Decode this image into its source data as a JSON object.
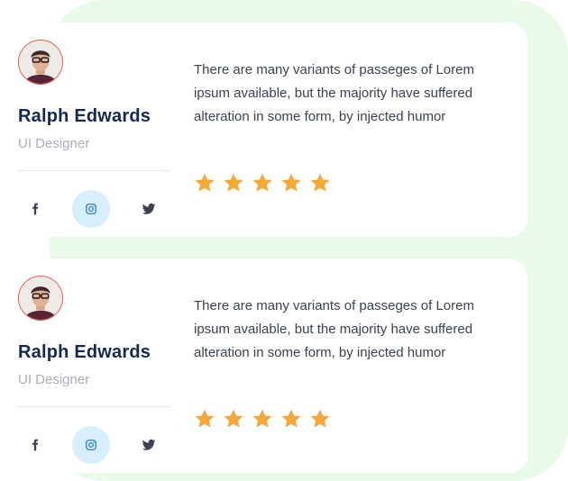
{
  "colors": {
    "background_shape": "#eafaea",
    "name": "#16284f",
    "role": "#a8adb7",
    "star": "#f8a839",
    "avatar_border": "#e8584d",
    "instagram_bg": "#d6eefe"
  },
  "testimonials": [
    {
      "name": "Ralph Edwards",
      "role": "UI Designer",
      "quote": "There are many variants of passeges of Lorem ipsum available, but the majority have suffered alteration in some form, by injected humor",
      "rating": 5,
      "social": [
        "facebook-icon",
        "instagram-icon",
        "twitter-icon"
      ]
    },
    {
      "name": "Ralph Edwards",
      "role": "UI Designer",
      "quote": "There are many variants of passeges of Lorem ipsum available, but the majority have suffered alteration in some form, by injected humor",
      "rating": 5,
      "social": [
        "facebook-icon",
        "instagram-icon",
        "twitter-icon"
      ]
    }
  ]
}
